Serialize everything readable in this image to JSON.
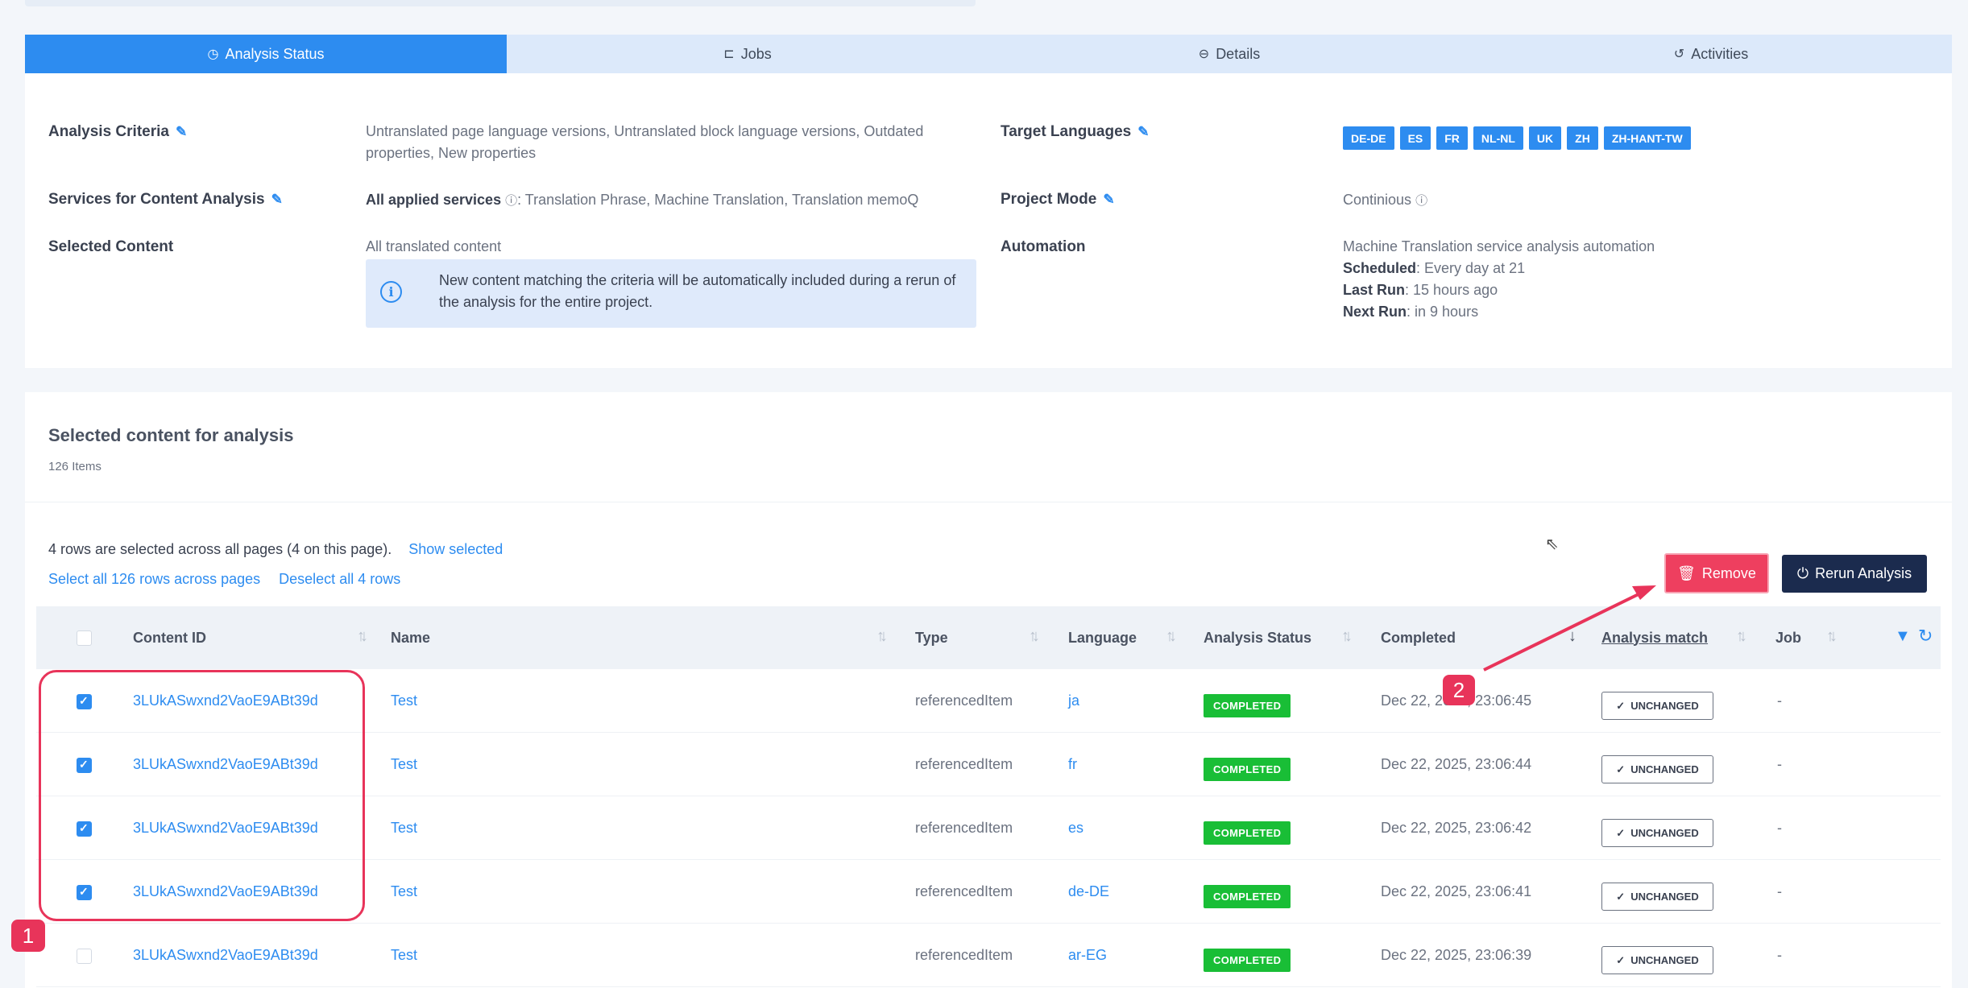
{
  "tabs": [
    {
      "label": "Analysis Status",
      "icon": "clock-icon",
      "active": true
    },
    {
      "label": "Jobs",
      "icon": "briefcase-icon",
      "active": false
    },
    {
      "label": "Details",
      "icon": "minus-circle-icon",
      "active": false
    },
    {
      "label": "Activities",
      "icon": "history-icon",
      "active": false
    }
  ],
  "summary": {
    "analysis_criteria_label": "Analysis Criteria",
    "analysis_criteria_value": "Untranslated page language versions, Untranslated block language versions, Outdated properties, New properties",
    "services_label": "Services for Content Analysis",
    "services_prefix": "All applied services",
    "services_value": ": Translation Phrase, Machine Translation, Translation memoQ",
    "selected_content_label": "Selected Content",
    "selected_content_value": "All translated content",
    "info_text": "New content matching the criteria will be automatically included during a rerun of the analysis for the entire project.",
    "target_languages_label": "Target Languages",
    "target_languages": [
      "DE-DE",
      "ES",
      "FR",
      "NL-NL",
      "UK",
      "ZH",
      "ZH-HANT-TW"
    ],
    "project_mode_label": "Project Mode",
    "project_mode_value": "Continious",
    "automation_label": "Automation",
    "automation_link": "Machine Translation service analysis automation",
    "scheduled_label": "Scheduled",
    "scheduled_value": ": Every day at 21",
    "last_run_label": "Last Run",
    "last_run_value": ": 15 hours ago",
    "next_run_label": "Next Run",
    "next_run_value": ": in 9 hours"
  },
  "content": {
    "title": "Selected content for analysis",
    "count": "126 Items",
    "selection_info": "4 rows are selected across all pages (4 on this page).",
    "show_selected": "Show selected",
    "select_all": "Select all 126 rows across pages",
    "deselect_all": "Deselect all 4 rows",
    "remove_label": "Remove",
    "rerun_label": "Rerun Analysis"
  },
  "table": {
    "columns": [
      "Content ID",
      "Name",
      "Type",
      "Language",
      "Analysis Status",
      "Completed",
      "Analysis match",
      "Job"
    ],
    "rows": [
      {
        "checked": true,
        "content_id": "3LUkASwxnd2VaoE9ABt39d",
        "name": "Test",
        "type": "referencedItem",
        "language": "ja",
        "status": "COMPLETED",
        "completed": "Dec 22, 2025, 23:06:45",
        "match": "UNCHANGED",
        "job": "-"
      },
      {
        "checked": true,
        "content_id": "3LUkASwxnd2VaoE9ABt39d",
        "name": "Test",
        "type": "referencedItem",
        "language": "fr",
        "status": "COMPLETED",
        "completed": "Dec 22, 2025, 23:06:44",
        "match": "UNCHANGED",
        "job": "-"
      },
      {
        "checked": true,
        "content_id": "3LUkASwxnd2VaoE9ABt39d",
        "name": "Test",
        "type": "referencedItem",
        "language": "es",
        "status": "COMPLETED",
        "completed": "Dec 22, 2025, 23:06:42",
        "match": "UNCHANGED",
        "job": "-"
      },
      {
        "checked": true,
        "content_id": "3LUkASwxnd2VaoE9ABt39d",
        "name": "Test",
        "type": "referencedItem",
        "language": "de-DE",
        "status": "COMPLETED",
        "completed": "Dec 22, 2025, 23:06:41",
        "match": "UNCHANGED",
        "job": "-"
      },
      {
        "checked": false,
        "content_id": "3LUkASwxnd2VaoE9ABt39d",
        "name": "Test",
        "type": "referencedItem",
        "language": "ar-EG",
        "status": "COMPLETED",
        "completed": "Dec 22, 2025, 23:06:39",
        "match": "UNCHANGED",
        "job": "-"
      }
    ]
  },
  "annotations": {
    "marker_1": "1",
    "marker_2": "2",
    "color": "#e8345a"
  },
  "colors": {
    "primary": "#2d8cf0",
    "success": "#19be36",
    "danger": "#ee3f5f",
    "navy": "#1b2b4e"
  }
}
